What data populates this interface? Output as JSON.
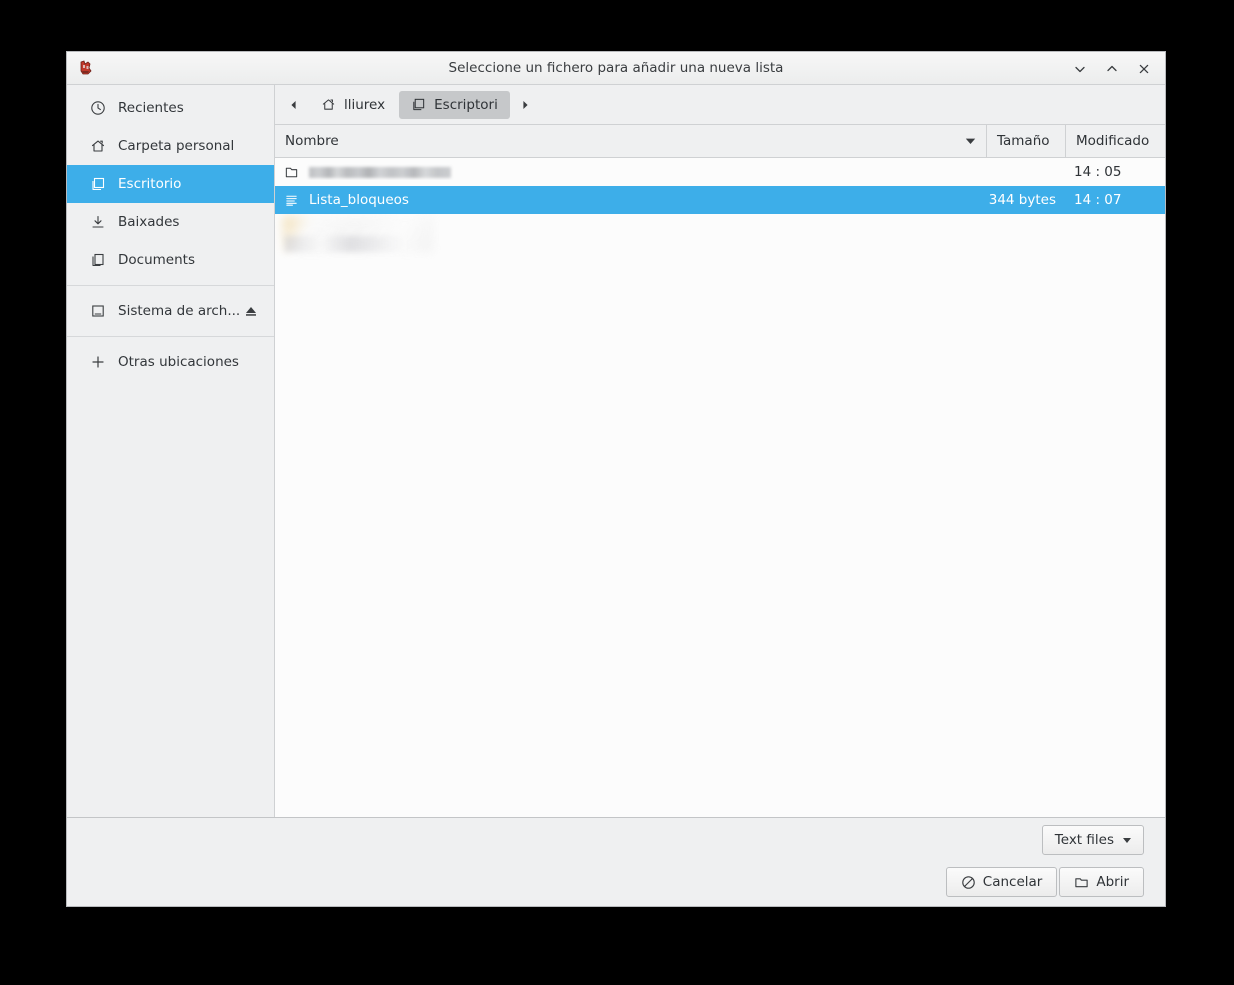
{
  "window": {
    "title": "Seleccione un fichero para añadir una nueva lista",
    "app_icon": "lliurex-app-icon",
    "controls": {
      "minimize": "minimize-icon",
      "maximize": "maximize-icon",
      "close": "close-icon"
    }
  },
  "sidebar": {
    "items": [
      {
        "label": "Recientes",
        "icon": "clock-icon",
        "selected": false
      },
      {
        "label": "Carpeta personal",
        "icon": "home-icon",
        "selected": false
      },
      {
        "label": "Escritorio",
        "icon": "desktop-icon",
        "selected": true
      },
      {
        "label": "Baixades",
        "icon": "download-icon",
        "selected": false
      },
      {
        "label": "Documents",
        "icon": "documents-icon",
        "selected": false
      },
      {
        "label": "Sistema de arch...",
        "icon": "drive-icon",
        "selected": false,
        "eject": true
      },
      {
        "label": "Otras ubicaciones",
        "icon": "plus-icon",
        "selected": false
      }
    ]
  },
  "pathbar": {
    "back_arrow": "chevron-left-icon",
    "forward_arrow": "chevron-right-icon",
    "crumbs": [
      {
        "label": "lliurex",
        "icon": "home-icon",
        "active": false
      },
      {
        "label": "Escriptori",
        "icon": "desktop-icon",
        "active": true
      }
    ]
  },
  "columns": {
    "name": "Nombre",
    "size": "Tamaño",
    "modified": "Modificado",
    "sorted_by": "name",
    "sort_direction": "descending"
  },
  "files": [
    {
      "name": "",
      "redacted": true,
      "icon": "file-icon",
      "size": "",
      "modified": "14 : 05",
      "selected": false
    },
    {
      "name": "Lista_bloqueos",
      "redacted": false,
      "icon": "text-file-icon",
      "size": "344 bytes",
      "modified": "14 : 07",
      "selected": true
    },
    {
      "name": "",
      "redacted": true,
      "ghost": true,
      "icon": "",
      "size": "",
      "modified": "",
      "selected": false
    }
  ],
  "footer": {
    "filter_label": "Text files",
    "cancel_label": "Cancelar",
    "open_label": "Abrir"
  },
  "colors": {
    "selection": "#3daee9",
    "window_bg": "#eff0f1",
    "list_bg": "#fcfcfc",
    "text": "#2f3337",
    "border": "#cfd1d3"
  }
}
